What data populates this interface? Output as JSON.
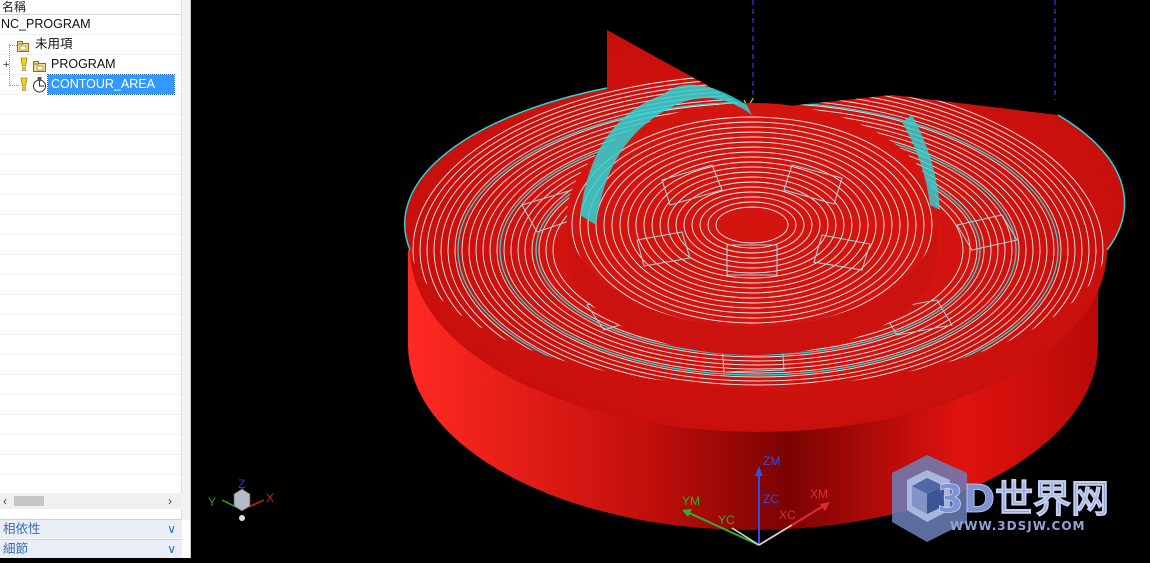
{
  "navigator": {
    "column_header": "名稱",
    "root": "NC_PROGRAM",
    "items": [
      {
        "label": "未用項",
        "icon": "folder-icon"
      },
      {
        "label": "PROGRAM",
        "icon": "program-folder-icon"
      },
      {
        "label": "CONTOUR_AREA",
        "icon": "operation-icon",
        "selected": true
      }
    ],
    "panels": [
      {
        "label": "相依性",
        "icon": "chevron-down-icon"
      },
      {
        "label": "細節",
        "icon": "chevron-down-icon"
      }
    ]
  },
  "viewport": {
    "mini_triad": {
      "x": "X",
      "y": "Y",
      "z": "Z"
    },
    "wcs_triad": {
      "zm": "ZM",
      "zc": "ZC",
      "ym": "YM",
      "yc": "YC",
      "xm": "XM",
      "xc": "XC"
    },
    "colors": {
      "part": "#e0120f",
      "toolpath": "#2ad4d4",
      "background": "#000000"
    }
  },
  "watermark": {
    "title": "3D世界网",
    "url": "WWW.3DSJW.COM"
  }
}
